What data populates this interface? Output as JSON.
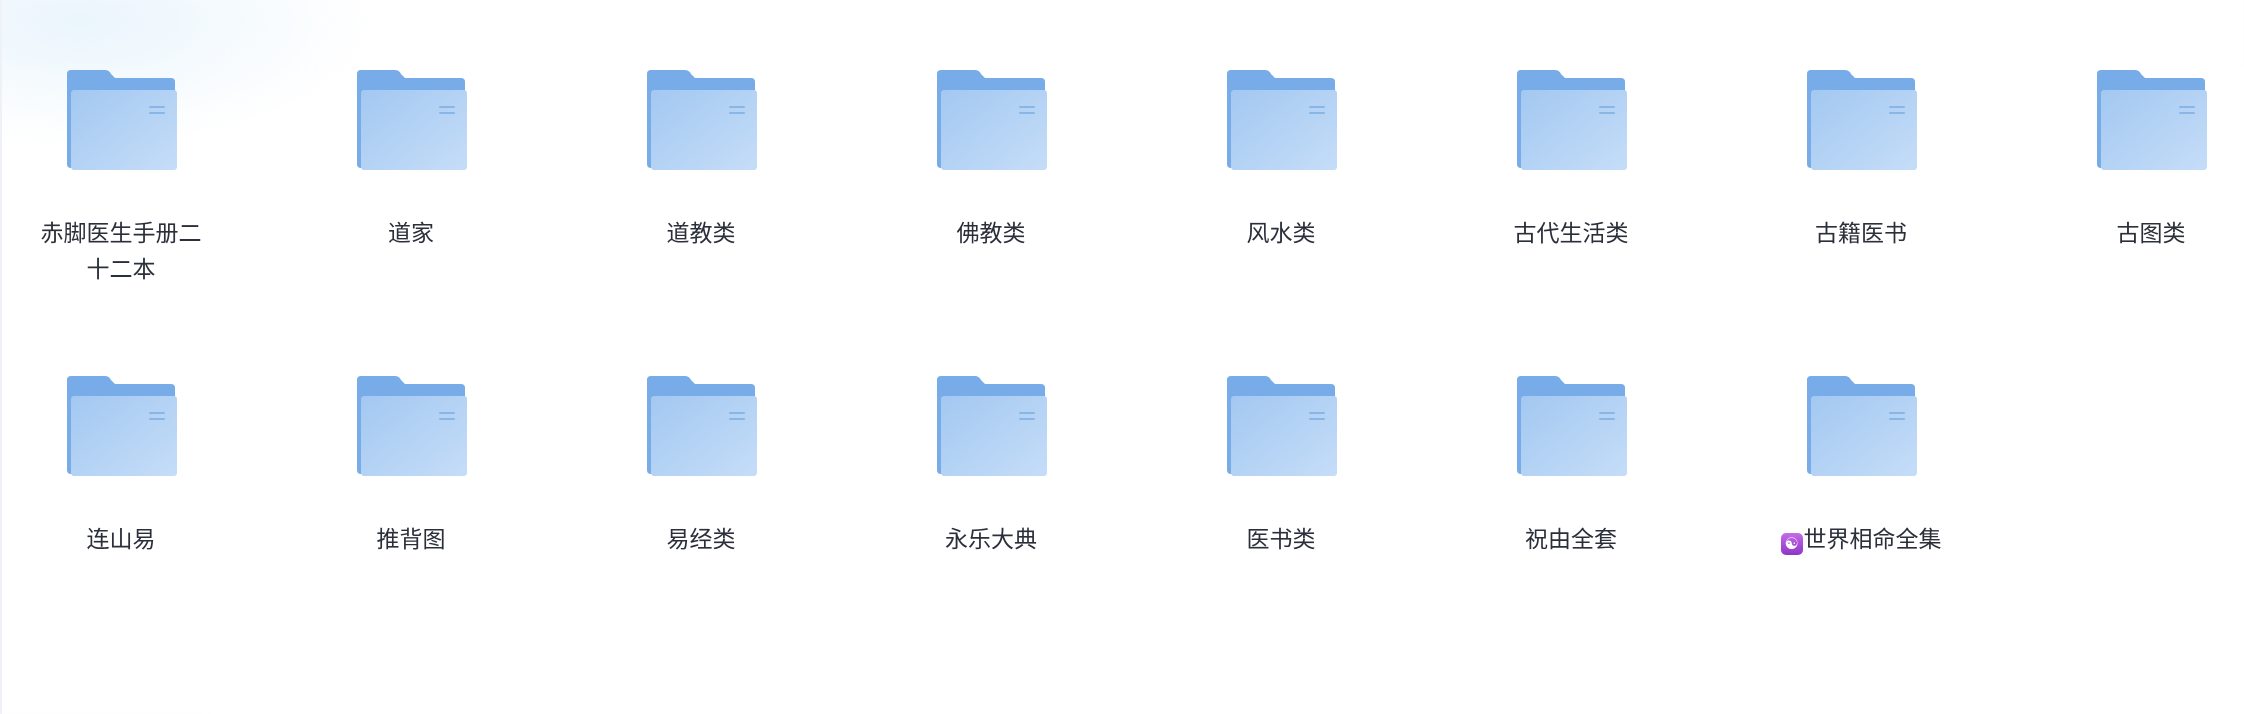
{
  "folders": [
    {
      "name": "赤脚医生手册二十二本"
    },
    {
      "name": "道家"
    },
    {
      "name": "道教类"
    },
    {
      "name": "佛教类"
    },
    {
      "name": "风水类"
    },
    {
      "name": "古代生活类"
    },
    {
      "name": "古籍医书"
    },
    {
      "name": "古图类"
    },
    {
      "name": "连山易"
    },
    {
      "name": "推背图"
    },
    {
      "name": "易经类"
    },
    {
      "name": "永乐大典"
    },
    {
      "name": "医书类"
    },
    {
      "name": "祝由全套"
    },
    {
      "name": "世界相命全集",
      "badge": "☯"
    }
  ],
  "colors": {
    "folder_back": "#78ace8",
    "folder_front_top": "#a9cdf3",
    "folder_front_bottom": "#c7def8",
    "label_text": "#2b2f3a"
  },
  "icons": {
    "folder": "folder-icon",
    "badge": "yin-yang-emoji"
  }
}
